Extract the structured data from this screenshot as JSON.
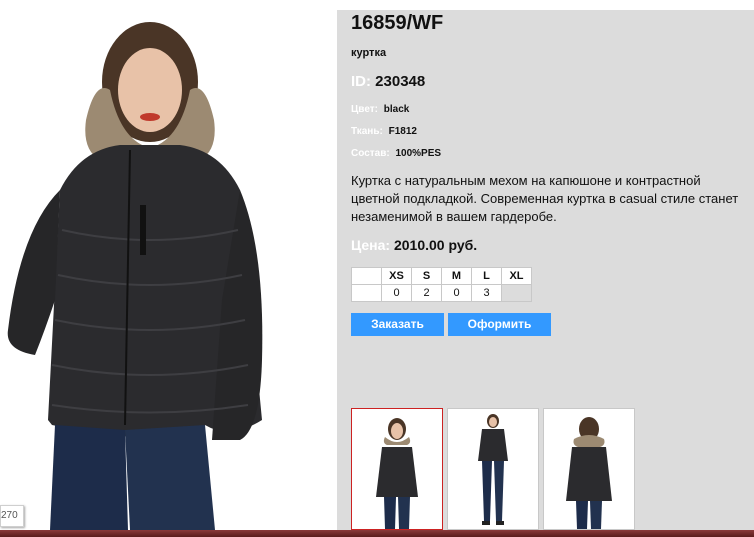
{
  "product": {
    "article": "16859/WF",
    "type": "куртка",
    "id_label": "ID:",
    "id_value": "230348",
    "color_label": "Цвет:",
    "color_value": "black",
    "fabric_label": "Ткань:",
    "fabric_value": "F1812",
    "composition_label": "Состав:",
    "composition_value": "100%PES",
    "description": "Куртка с натуральным мехом на капюшоне и контрастной цветной подкладкой. Современная куртка в casual стиле станет незаменимой в вашем гардеробе.",
    "price_label": "Цена:",
    "price_value": "2010.00 руб."
  },
  "sizes": {
    "headers": [
      "XS",
      "S",
      "M",
      "L",
      "XL"
    ],
    "quantities": [
      "0",
      "2",
      "0",
      "3",
      ""
    ]
  },
  "buttons": {
    "order": "Заказать",
    "checkout": "Оформить"
  },
  "photo_badge": "270",
  "colors": {
    "panel_bg": "#dcdcdc",
    "button_bg": "#3399ff",
    "label_color": "#ffffff",
    "selected_thumb_border": "#cc2222"
  }
}
